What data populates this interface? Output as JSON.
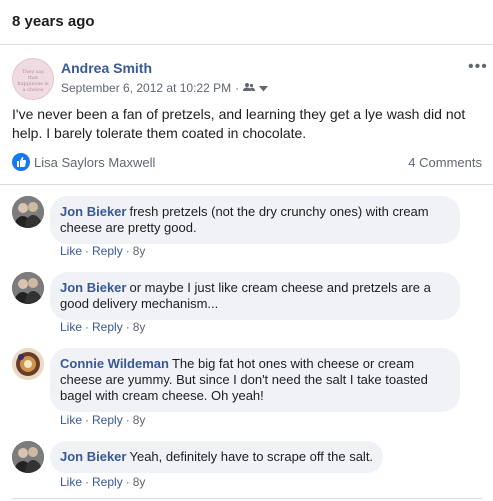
{
  "header": {
    "title": "8 years ago"
  },
  "post": {
    "author": "Andrea Smith",
    "date": "September 6, 2012 at 10:22 PM",
    "privacy_icon": "friends-icon",
    "text": "I've never been a fan of pretzels, and learning they get a lye wash did not help. I barely tolerate them coated in chocolate.",
    "likers": "Lisa Saylors Maxwell",
    "comments_count": "4 Comments",
    "avatar_text": "They say that happiness is a choice"
  },
  "comments": [
    {
      "name": "Jon Bieker",
      "text": "fresh pretzels (not the dry crunchy ones) with cream cheese are pretty good.",
      "like": "Like",
      "reply": "Reply",
      "time": "8y"
    },
    {
      "name": "Jon Bieker",
      "text": "or maybe I just like cream cheese and pretzels are a good delivery mechanism...",
      "like": "Like",
      "reply": "Reply",
      "time": "8y"
    },
    {
      "name": "Connie Wildeman",
      "text": "The big fat hot ones with cheese or cream cheese are yummy. But since I don't need the salt I take toasted bagel with cream cheese. Oh yeah!",
      "like": "Like",
      "reply": "Reply",
      "time": "8y"
    },
    {
      "name": "Jon Bieker",
      "text": "Yeah, definitely have to scrape off the salt.",
      "like": "Like",
      "reply": "Reply",
      "time": "8y"
    }
  ],
  "separator": "·",
  "colors": {
    "link": "#385898",
    "like_blue": "#1877f2",
    "bubble": "#f0f2f5",
    "meta": "#606770"
  }
}
